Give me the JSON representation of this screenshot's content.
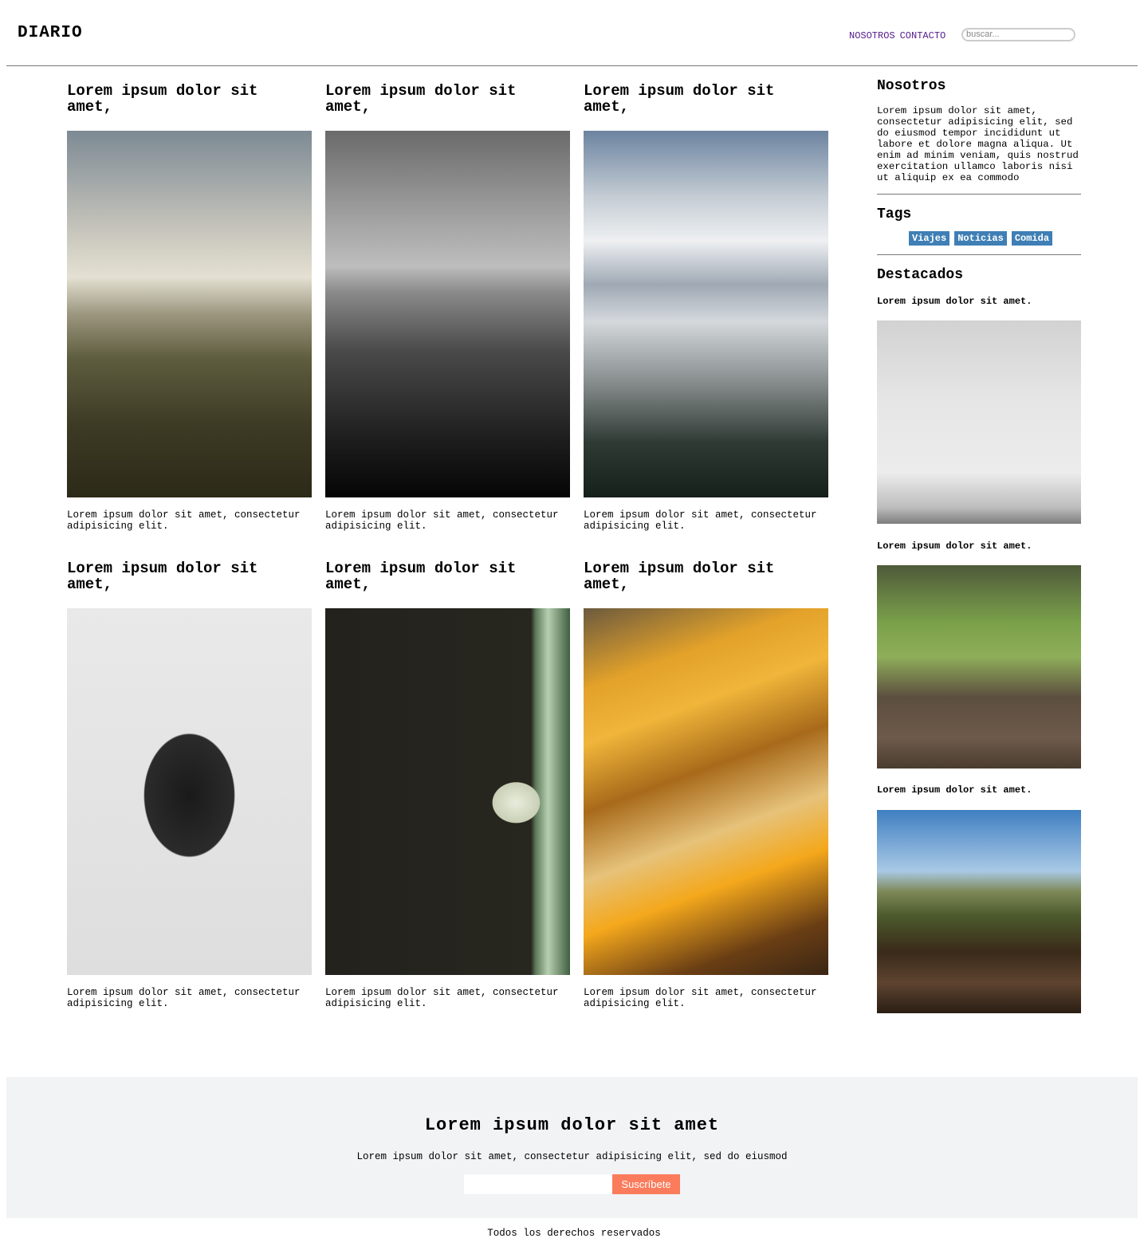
{
  "header": {
    "logo": "DIARIO",
    "nav": [
      "NOSOTROS",
      "CONTACTO"
    ],
    "search_placeholder": "buscar..."
  },
  "posts": [
    {
      "title": "Lorem ipsum dolor sit amet,",
      "text": "Lorem ipsum dolor sit amet, consectetur adipisicing elit."
    },
    {
      "title": "Lorem ipsum dolor sit amet,",
      "text": "Lorem ipsum dolor sit amet, consectetur adipisicing elit."
    },
    {
      "title": "Lorem ipsum dolor sit amet,",
      "text": "Lorem ipsum dolor sit amet, consectetur adipisicing elit."
    },
    {
      "title": "Lorem ipsum dolor sit amet,",
      "text": "Lorem ipsum dolor sit amet, consectetur adipisicing elit."
    },
    {
      "title": "Lorem ipsum dolor sit amet,",
      "text": "Lorem ipsum dolor sit amet, consectetur adipisicing elit."
    },
    {
      "title": "Lorem ipsum dolor sit amet,",
      "text": "Lorem ipsum dolor sit amet, consectetur adipisicing elit."
    }
  ],
  "sidebar": {
    "about_title": "Nosotros",
    "about_text": "Lorem ipsum dolor sit amet, consectetur adipisicing elit, sed do eiusmod tempor incididunt ut labore et dolore magna aliqua. Ut enim ad minim veniam, quis nostrud exercitation ullamco laboris nisi ut aliquip ex ea commodo",
    "tags_title": "Tags",
    "tags": [
      "Viajes",
      "Noticias",
      "Comida"
    ],
    "featured_title": "Destacados",
    "featured": [
      {
        "title": "Lorem ipsum dolor sit amet."
      },
      {
        "title": "Lorem ipsum dolor sit amet."
      },
      {
        "title": "Lorem ipsum dolor sit amet."
      }
    ]
  },
  "footer": {
    "title": "Lorem ipsum dolor sit amet",
    "text": "Lorem ipsum dolor sit amet, consectetur adipisicing elit, sed do eiusmod",
    "button": "Suscríbete",
    "copyright": "Todos los derechos reservados"
  },
  "colors": {
    "tag": "#3f7fb5",
    "button": "#fa7c5c",
    "nav_link": "#551a8b",
    "footer_bg": "#f2f3f5"
  }
}
